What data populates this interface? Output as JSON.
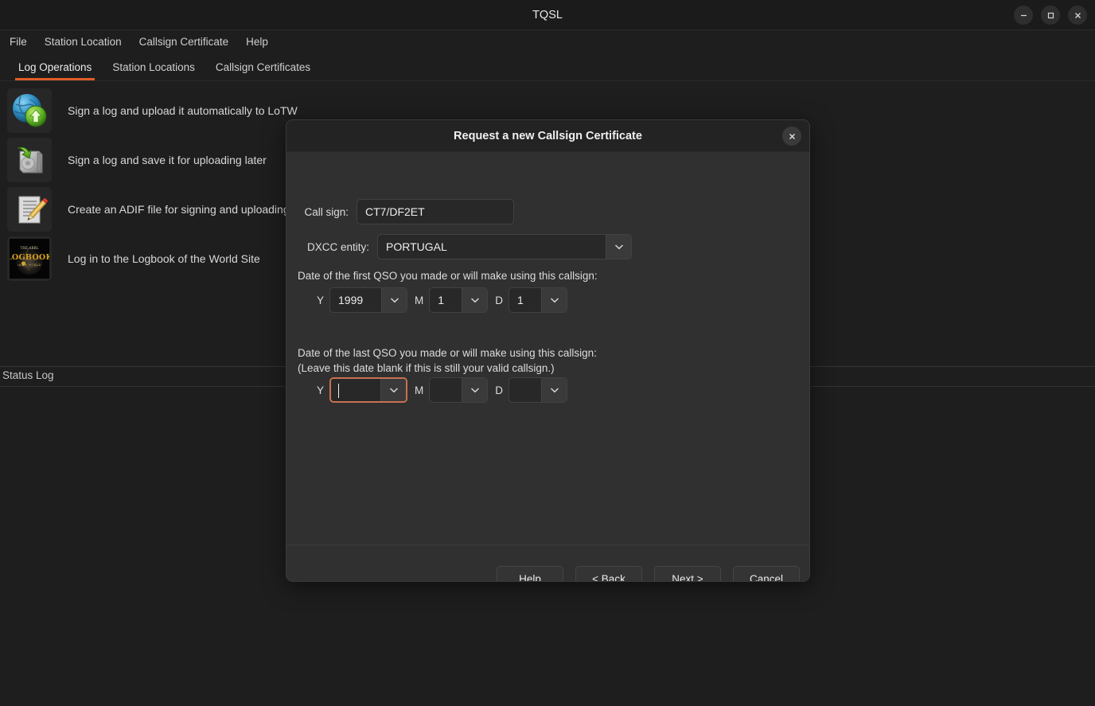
{
  "window": {
    "title": "TQSL",
    "controls": [
      {
        "name": "minimize",
        "glyph": "minimize-icon"
      },
      {
        "name": "maximize",
        "glyph": "maximize-icon"
      },
      {
        "name": "close",
        "glyph": "close-icon"
      }
    ]
  },
  "menubar": {
    "items": [
      {
        "label": "File"
      },
      {
        "label": "Station Location"
      },
      {
        "label": "Callsign Certificate"
      },
      {
        "label": "Help"
      }
    ]
  },
  "tabs": {
    "active_index": 0,
    "items": [
      {
        "label": "Log Operations"
      },
      {
        "label": "Station Locations"
      },
      {
        "label": "Callsign Certificates"
      }
    ]
  },
  "actions": [
    {
      "icon": "globe-upload-icon",
      "label": "Sign a log and upload it automatically to LoTW"
    },
    {
      "icon": "drive-save-icon",
      "label": "Sign a log and save it for uploading later"
    },
    {
      "icon": "document-pencil-icon",
      "label": "Create an ADIF file for signing and uploading"
    },
    {
      "icon": "lotw-logo-icon",
      "label": "Log in to the Logbook of the World Site"
    }
  ],
  "status_log": {
    "label": "Status Log",
    "content": ""
  },
  "dialog": {
    "title": "Request a new Callsign Certificate",
    "close_label": "close-icon",
    "callsign": {
      "label": "Call sign:",
      "value": "CT7/DF2ET",
      "placeholder": ""
    },
    "dxcc": {
      "label": "DXCC entity:",
      "value": "PORTUGAL"
    },
    "first_qso": {
      "prompt": "Date of the first QSO you made or will make using this callsign:",
      "year_marker": "Y",
      "year": "1999",
      "month_marker": "M",
      "month": "1",
      "day_marker": "D",
      "day": "1"
    },
    "last_qso": {
      "prompt_line1": "Date of the last QSO you made or will make using this callsign:",
      "prompt_line2": "(Leave this date blank if this is still your valid callsign.)",
      "year_marker": "Y",
      "year": "",
      "month_marker": "M",
      "month": "",
      "day_marker": "D",
      "day": ""
    },
    "buttons": [
      {
        "label": "Help"
      },
      {
        "label": "< Back"
      },
      {
        "label": "Next >"
      },
      {
        "label": "Cancel"
      }
    ]
  },
  "colors": {
    "accent_tab": "#e05c28",
    "focus_border": "#c97152",
    "window_bg": "#1e1e1e",
    "dialog_bg": "#303030",
    "dialog_header_bg": "#232323"
  }
}
